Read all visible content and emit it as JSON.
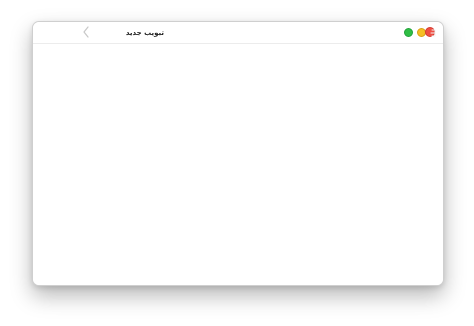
{
  "window": {
    "title": "تبويب جديد"
  },
  "toolbar": {
    "back_icon": "chevron-left-icon"
  },
  "window_controls": {
    "green": "#2fbe45",
    "yellow": "#f5bf24",
    "red": "#ef4e43"
  }
}
